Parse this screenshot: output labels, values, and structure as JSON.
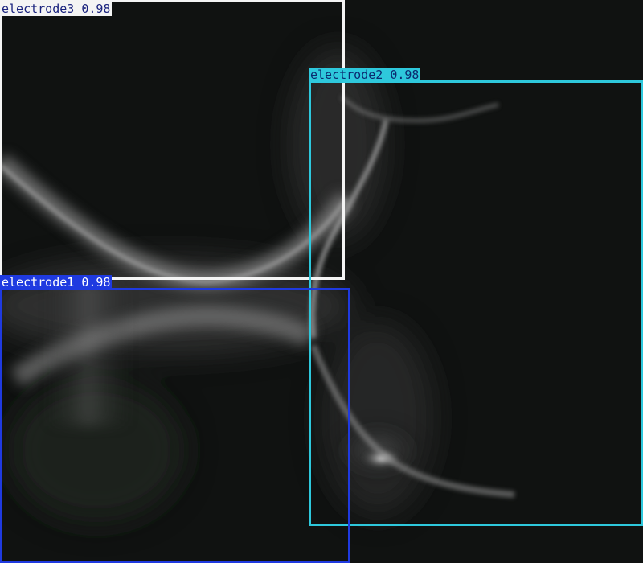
{
  "image": {
    "description_colors": {
      "background": "#101211",
      "glow": "#d8d8d8"
    }
  },
  "detections": [
    {
      "id": "electrode3",
      "label": "electrode3 0.98",
      "class_name": "electrode3",
      "confidence": "0.98",
      "box_color": "#f4f4f4",
      "label_bg": "#f4f4f4",
      "label_fg": "#1a237e"
    },
    {
      "id": "electrode2",
      "label": "electrode2 0.98",
      "class_name": "electrode2",
      "confidence": "0.98",
      "box_color": "#2ec8dc",
      "label_bg": "#2ec8dc",
      "label_fg": "#0b2a6f"
    },
    {
      "id": "electrode1",
      "label": "electrode1 0.98",
      "class_name": "electrode1",
      "confidence": "0.98",
      "box_color": "#1f3ae0",
      "label_bg": "#1f3ae0",
      "label_fg": "#ffffff"
    }
  ]
}
